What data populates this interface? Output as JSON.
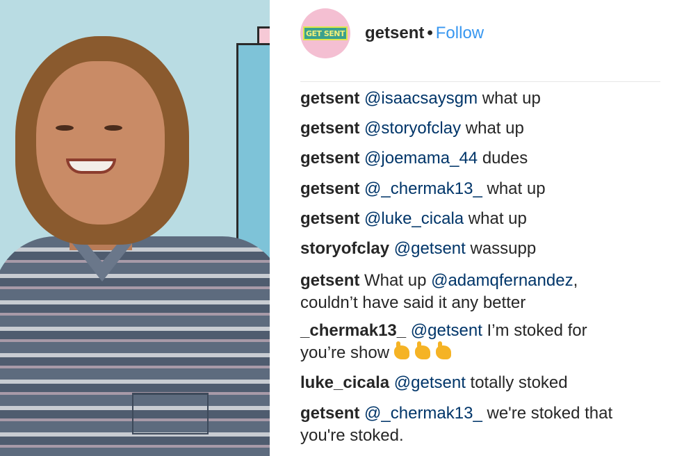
{
  "post": {
    "username": "getsent",
    "separator": "•",
    "follow_label": "Follow",
    "avatar_logo_text": "GET SENT"
  },
  "comments": [
    {
      "user": "getsent",
      "mention": "@isaacsaysgm",
      "text": " what up"
    },
    {
      "user": "getsent",
      "mention": "@storyofclay",
      "text": " what up"
    },
    {
      "user": "getsent",
      "mention": "@joemama_44",
      "text": " dudes"
    },
    {
      "user": "getsent",
      "mention": "@_chermak13_",
      "text": " what up"
    },
    {
      "user": "getsent",
      "mention": "@luke_cicala",
      "text": " what up"
    },
    {
      "user": "storyofclay",
      "mention": "@getsent",
      "text": " wassupp"
    },
    {
      "user": "getsent",
      "pre_text": "What up ",
      "mention": "@adamqfernandez",
      "text": ",",
      "line2": "couldn’t have said it any better"
    },
    {
      "user": "_chermak13_",
      "mention": "@getsent",
      "text": " I’m stoked for",
      "line2": "you’re show",
      "emoji": "call-me-hand-icon"
    },
    {
      "user": "luke_cicala",
      "mention": "@getsent",
      "text": " totally stoked"
    },
    {
      "user": "getsent",
      "mention": "@_chermak13_",
      "text": " we're stoked that",
      "line2": "you're stoked."
    }
  ],
  "colors": {
    "follow": "#3897f0",
    "mention": "#003569",
    "text": "#262626",
    "media_background": "#b9dce3"
  }
}
